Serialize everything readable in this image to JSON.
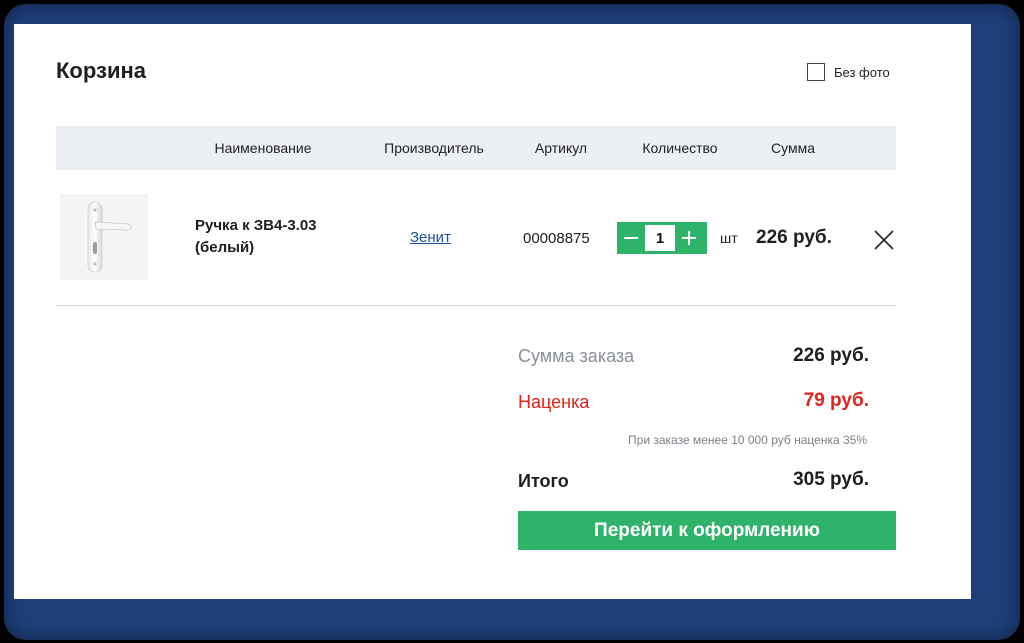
{
  "cart": {
    "title": "Корзина",
    "no_photo_label": "Без фото",
    "columns": {
      "name": "Наименование",
      "manufacturer": "Производитель",
      "article": "Артикул",
      "quantity": "Количество",
      "sum": "Сумма"
    },
    "items": [
      {
        "name": "Ручка к ЗВ4-3.03 (белый)",
        "manufacturer": "Зенит",
        "article": "00008875",
        "quantity": "1",
        "unit": "шт",
        "sum": "226 руб.",
        "image": "door-handle-icon"
      }
    ],
    "summary": {
      "order_sum_label": "Сумма заказа",
      "order_sum_value": "226 руб.",
      "markup_label": "Наценка",
      "markup_value": "79 руб.",
      "markup_note": "При заказе менее 10 000 руб наценка 35%",
      "total_label": "Итого",
      "total_value": "305 руб."
    },
    "checkout_label": "Перейти к оформлению"
  },
  "colors": {
    "accent_green": "#2fb36b",
    "markup_red": "#e0231b",
    "link_blue": "#1b4f9c",
    "header_gray": "#eceff3"
  }
}
